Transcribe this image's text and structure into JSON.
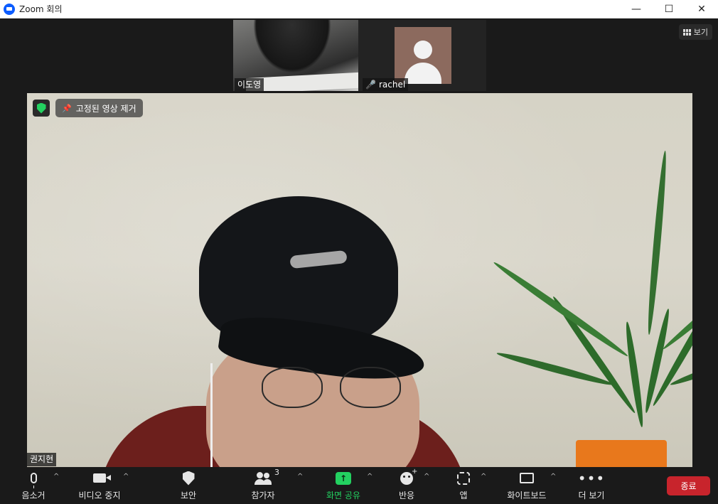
{
  "window": {
    "title": "Zoom 회의",
    "controls": {
      "minimize": "—",
      "maximize": "☐",
      "close": "✕"
    }
  },
  "header": {
    "view_label": "보기"
  },
  "participants_strip": [
    {
      "name": "이도영",
      "muted": false
    },
    {
      "name": "rachel",
      "muted": true
    }
  ],
  "main_video": {
    "participant_name": "권지현",
    "unpin_label": "고정된 영상 제거"
  },
  "toolbar": {
    "mute_label": "음소거",
    "video_label": "비디오 중지",
    "security_label": "보안",
    "participants_label": "참가자",
    "participants_count": "3",
    "share_label": "화면 공유",
    "reactions_label": "반응",
    "apps_label": "앱",
    "whiteboard_label": "화이트보드",
    "more_label": "더 보기",
    "end_label": "종료",
    "caret": "^"
  },
  "colors": {
    "accent_green": "#23d160",
    "end_red": "#c8242c",
    "brand_blue": "#0b5cff",
    "avatar_bg": "#8c6a5e"
  },
  "icons": {
    "mute": "microphone-icon",
    "video": "video-camera-icon",
    "security": "shield-icon",
    "participants": "people-icon",
    "share": "share-screen-icon",
    "reactions": "smiley-icon",
    "apps": "apps-icon",
    "whiteboard": "whiteboard-icon",
    "more": "more-dots-icon",
    "pin": "pin-icon"
  }
}
